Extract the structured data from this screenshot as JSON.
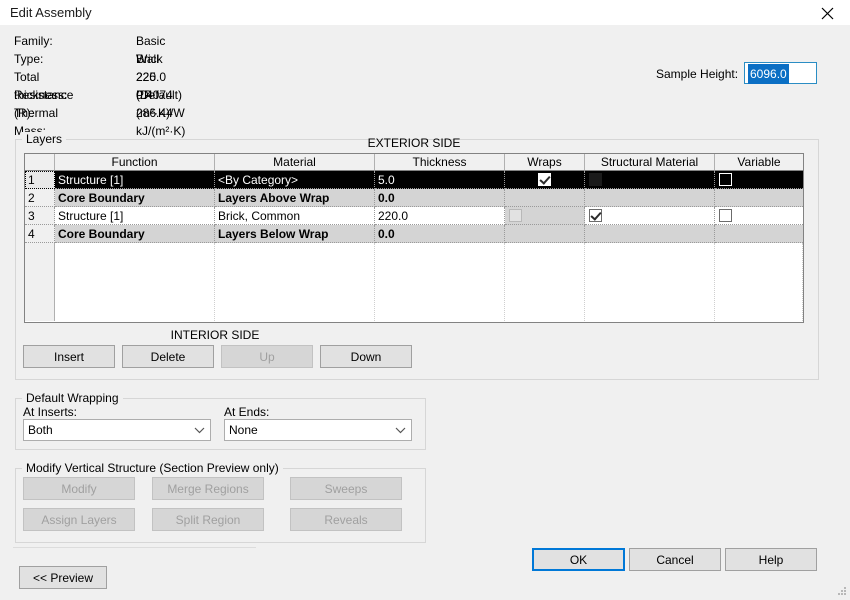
{
  "window": {
    "title": "Edit Assembly",
    "close_icon": "close-icon"
  },
  "info": {
    "rows": [
      {
        "label": "Family:",
        "value": "Basic Wall"
      },
      {
        "label": "Type:",
        "value": "Brick 220 PP"
      },
      {
        "label": "Total thickness:",
        "value": "225.0 (Default)"
      },
      {
        "label": "Resistance (R):",
        "value": "0.4074 (m²·K)/W"
      },
      {
        "label": "Thermal Mass:",
        "value": "286.44 kJ/(m²·K)"
      }
    ]
  },
  "sample_height": {
    "label": "Sample Height:",
    "value": "6096.0",
    "selected": true
  },
  "layers": {
    "legend": "Layers",
    "exterior_label": "EXTERIOR SIDE",
    "interior_label": "INTERIOR SIDE",
    "columns": [
      "",
      "Function",
      "Material",
      "Thickness",
      "Wraps",
      "Structural Material",
      "Variable"
    ],
    "rows": [
      {
        "num": "1",
        "function": "Structure [1]",
        "material": "<By Category>",
        "thickness": "5.0",
        "wraps": "checked",
        "structural_material": "dark",
        "variable": "unchecked",
        "selected": true,
        "bold": false
      },
      {
        "num": "2",
        "function": "Core Boundary",
        "material": "Layers Above Wrap",
        "thickness": "0.0",
        "wraps": "none",
        "structural_material": "none",
        "variable": "none",
        "selected": false,
        "bold": true
      },
      {
        "num": "3",
        "function": "Structure [1]",
        "material": "Brick, Common",
        "thickness": "220.0",
        "wraps": "disabled",
        "structural_material": "checked",
        "variable": "unchecked",
        "selected": false,
        "bold": false
      },
      {
        "num": "4",
        "function": "Core Boundary",
        "material": "Layers Below Wrap",
        "thickness": "0.0",
        "wraps": "none",
        "structural_material": "none",
        "variable": "none",
        "selected": false,
        "bold": true
      }
    ],
    "buttons": [
      {
        "label": "Insert",
        "disabled": false
      },
      {
        "label": "Delete",
        "disabled": false
      },
      {
        "label": "Up",
        "disabled": true
      },
      {
        "label": "Down",
        "disabled": false
      }
    ]
  },
  "default_wrapping": {
    "legend": "Default Wrapping",
    "at_inserts": {
      "label": "At Inserts:",
      "value": "Both"
    },
    "at_ends": {
      "label": "At  Ends:",
      "value": "None"
    }
  },
  "modify_vertical": {
    "legend": "Modify Vertical Structure (Section Preview only)",
    "buttons": [
      {
        "label": "Modify",
        "disabled": true
      },
      {
        "label": "Merge Regions",
        "disabled": true
      },
      {
        "label": "Sweeps",
        "disabled": true
      },
      {
        "label": "Assign Layers",
        "disabled": true
      },
      {
        "label": "Split Region",
        "disabled": true
      },
      {
        "label": "Reveals",
        "disabled": true
      }
    ]
  },
  "footer": {
    "preview": "<< Preview",
    "ok": "OK",
    "cancel": "Cancel",
    "help": "Help"
  },
  "colors": {
    "background": "#f0f0f0",
    "accent": "#0078d7",
    "selection": "#0b6fc4",
    "row_selected": "#000000",
    "row_bold": "#d4d4d4"
  }
}
